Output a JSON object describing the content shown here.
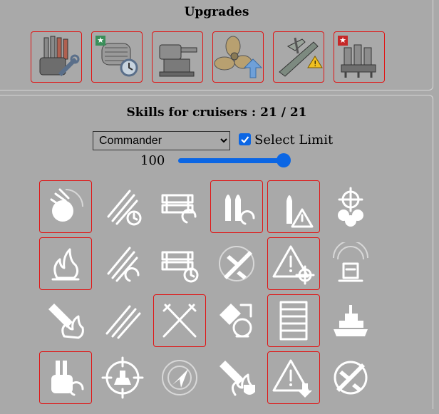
{
  "upgrades": {
    "title": "Upgrades",
    "items": [
      {
        "icon": "main-battery-modification-icon",
        "badge": ""
      },
      {
        "icon": "aiming-systems-modification-icon",
        "badge": "★"
      },
      {
        "icon": "secondary-battery-modification-icon",
        "badge": ""
      },
      {
        "icon": "propulsion-modification-icon",
        "badge": ""
      },
      {
        "icon": "aircraft-modification-icon",
        "badge": ""
      },
      {
        "icon": "engine-modification-icon",
        "badge": "★"
      }
    ]
  },
  "skills": {
    "title": "Skills for cruisers : 21 / 21",
    "commander_select": {
      "selected": "Commander"
    },
    "select_limit": {
      "label": "Select Limit",
      "checked": true
    },
    "limit_value": "100",
    "slider": {
      "value": 100,
      "max": 100
    }
  }
}
